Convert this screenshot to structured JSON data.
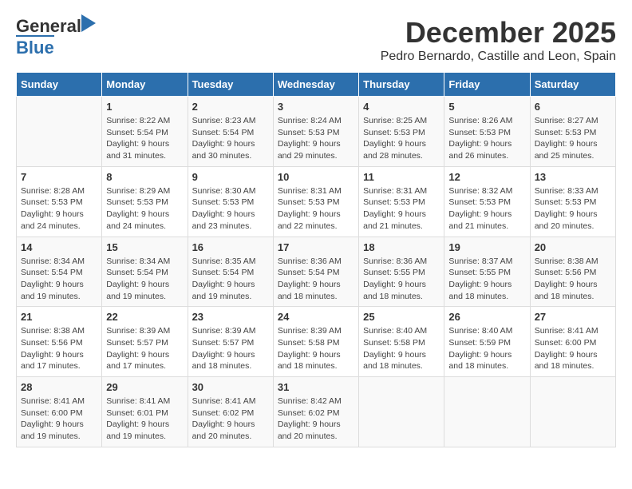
{
  "logo": {
    "line1": "General",
    "line2": "Blue"
  },
  "title": "December 2025",
  "subtitle": "Pedro Bernardo, Castille and Leon, Spain",
  "days_header": [
    "Sunday",
    "Monday",
    "Tuesday",
    "Wednesday",
    "Thursday",
    "Friday",
    "Saturday"
  ],
  "weeks": [
    {
      "cells": [
        {
          "day": "",
          "info": ""
        },
        {
          "day": "1",
          "info": "Sunrise: 8:22 AM\nSunset: 5:54 PM\nDaylight: 9 hours\nand 31 minutes."
        },
        {
          "day": "2",
          "info": "Sunrise: 8:23 AM\nSunset: 5:54 PM\nDaylight: 9 hours\nand 30 minutes."
        },
        {
          "day": "3",
          "info": "Sunrise: 8:24 AM\nSunset: 5:53 PM\nDaylight: 9 hours\nand 29 minutes."
        },
        {
          "day": "4",
          "info": "Sunrise: 8:25 AM\nSunset: 5:53 PM\nDaylight: 9 hours\nand 28 minutes."
        },
        {
          "day": "5",
          "info": "Sunrise: 8:26 AM\nSunset: 5:53 PM\nDaylight: 9 hours\nand 26 minutes."
        },
        {
          "day": "6",
          "info": "Sunrise: 8:27 AM\nSunset: 5:53 PM\nDaylight: 9 hours\nand 25 minutes."
        }
      ]
    },
    {
      "cells": [
        {
          "day": "7",
          "info": "Sunrise: 8:28 AM\nSunset: 5:53 PM\nDaylight: 9 hours\nand 24 minutes."
        },
        {
          "day": "8",
          "info": "Sunrise: 8:29 AM\nSunset: 5:53 PM\nDaylight: 9 hours\nand 24 minutes."
        },
        {
          "day": "9",
          "info": "Sunrise: 8:30 AM\nSunset: 5:53 PM\nDaylight: 9 hours\nand 23 minutes."
        },
        {
          "day": "10",
          "info": "Sunrise: 8:31 AM\nSunset: 5:53 PM\nDaylight: 9 hours\nand 22 minutes."
        },
        {
          "day": "11",
          "info": "Sunrise: 8:31 AM\nSunset: 5:53 PM\nDaylight: 9 hours\nand 21 minutes."
        },
        {
          "day": "12",
          "info": "Sunrise: 8:32 AM\nSunset: 5:53 PM\nDaylight: 9 hours\nand 21 minutes."
        },
        {
          "day": "13",
          "info": "Sunrise: 8:33 AM\nSunset: 5:53 PM\nDaylight: 9 hours\nand 20 minutes."
        }
      ]
    },
    {
      "cells": [
        {
          "day": "14",
          "info": "Sunrise: 8:34 AM\nSunset: 5:54 PM\nDaylight: 9 hours\nand 19 minutes."
        },
        {
          "day": "15",
          "info": "Sunrise: 8:34 AM\nSunset: 5:54 PM\nDaylight: 9 hours\nand 19 minutes."
        },
        {
          "day": "16",
          "info": "Sunrise: 8:35 AM\nSunset: 5:54 PM\nDaylight: 9 hours\nand 19 minutes."
        },
        {
          "day": "17",
          "info": "Sunrise: 8:36 AM\nSunset: 5:54 PM\nDaylight: 9 hours\nand 18 minutes."
        },
        {
          "day": "18",
          "info": "Sunrise: 8:36 AM\nSunset: 5:55 PM\nDaylight: 9 hours\nand 18 minutes."
        },
        {
          "day": "19",
          "info": "Sunrise: 8:37 AM\nSunset: 5:55 PM\nDaylight: 9 hours\nand 18 minutes."
        },
        {
          "day": "20",
          "info": "Sunrise: 8:38 AM\nSunset: 5:56 PM\nDaylight: 9 hours\nand 18 minutes."
        }
      ]
    },
    {
      "cells": [
        {
          "day": "21",
          "info": "Sunrise: 8:38 AM\nSunset: 5:56 PM\nDaylight: 9 hours\nand 17 minutes."
        },
        {
          "day": "22",
          "info": "Sunrise: 8:39 AM\nSunset: 5:57 PM\nDaylight: 9 hours\nand 17 minutes."
        },
        {
          "day": "23",
          "info": "Sunrise: 8:39 AM\nSunset: 5:57 PM\nDaylight: 9 hours\nand 18 minutes."
        },
        {
          "day": "24",
          "info": "Sunrise: 8:39 AM\nSunset: 5:58 PM\nDaylight: 9 hours\nand 18 minutes."
        },
        {
          "day": "25",
          "info": "Sunrise: 8:40 AM\nSunset: 5:58 PM\nDaylight: 9 hours\nand 18 minutes."
        },
        {
          "day": "26",
          "info": "Sunrise: 8:40 AM\nSunset: 5:59 PM\nDaylight: 9 hours\nand 18 minutes."
        },
        {
          "day": "27",
          "info": "Sunrise: 8:41 AM\nSunset: 6:00 PM\nDaylight: 9 hours\nand 18 minutes."
        }
      ]
    },
    {
      "cells": [
        {
          "day": "28",
          "info": "Sunrise: 8:41 AM\nSunset: 6:00 PM\nDaylight: 9 hours\nand 19 minutes."
        },
        {
          "day": "29",
          "info": "Sunrise: 8:41 AM\nSunset: 6:01 PM\nDaylight: 9 hours\nand 19 minutes."
        },
        {
          "day": "30",
          "info": "Sunrise: 8:41 AM\nSunset: 6:02 PM\nDaylight: 9 hours\nand 20 minutes."
        },
        {
          "day": "31",
          "info": "Sunrise: 8:42 AM\nSunset: 6:02 PM\nDaylight: 9 hours\nand 20 minutes."
        },
        {
          "day": "",
          "info": ""
        },
        {
          "day": "",
          "info": ""
        },
        {
          "day": "",
          "info": ""
        }
      ]
    }
  ]
}
